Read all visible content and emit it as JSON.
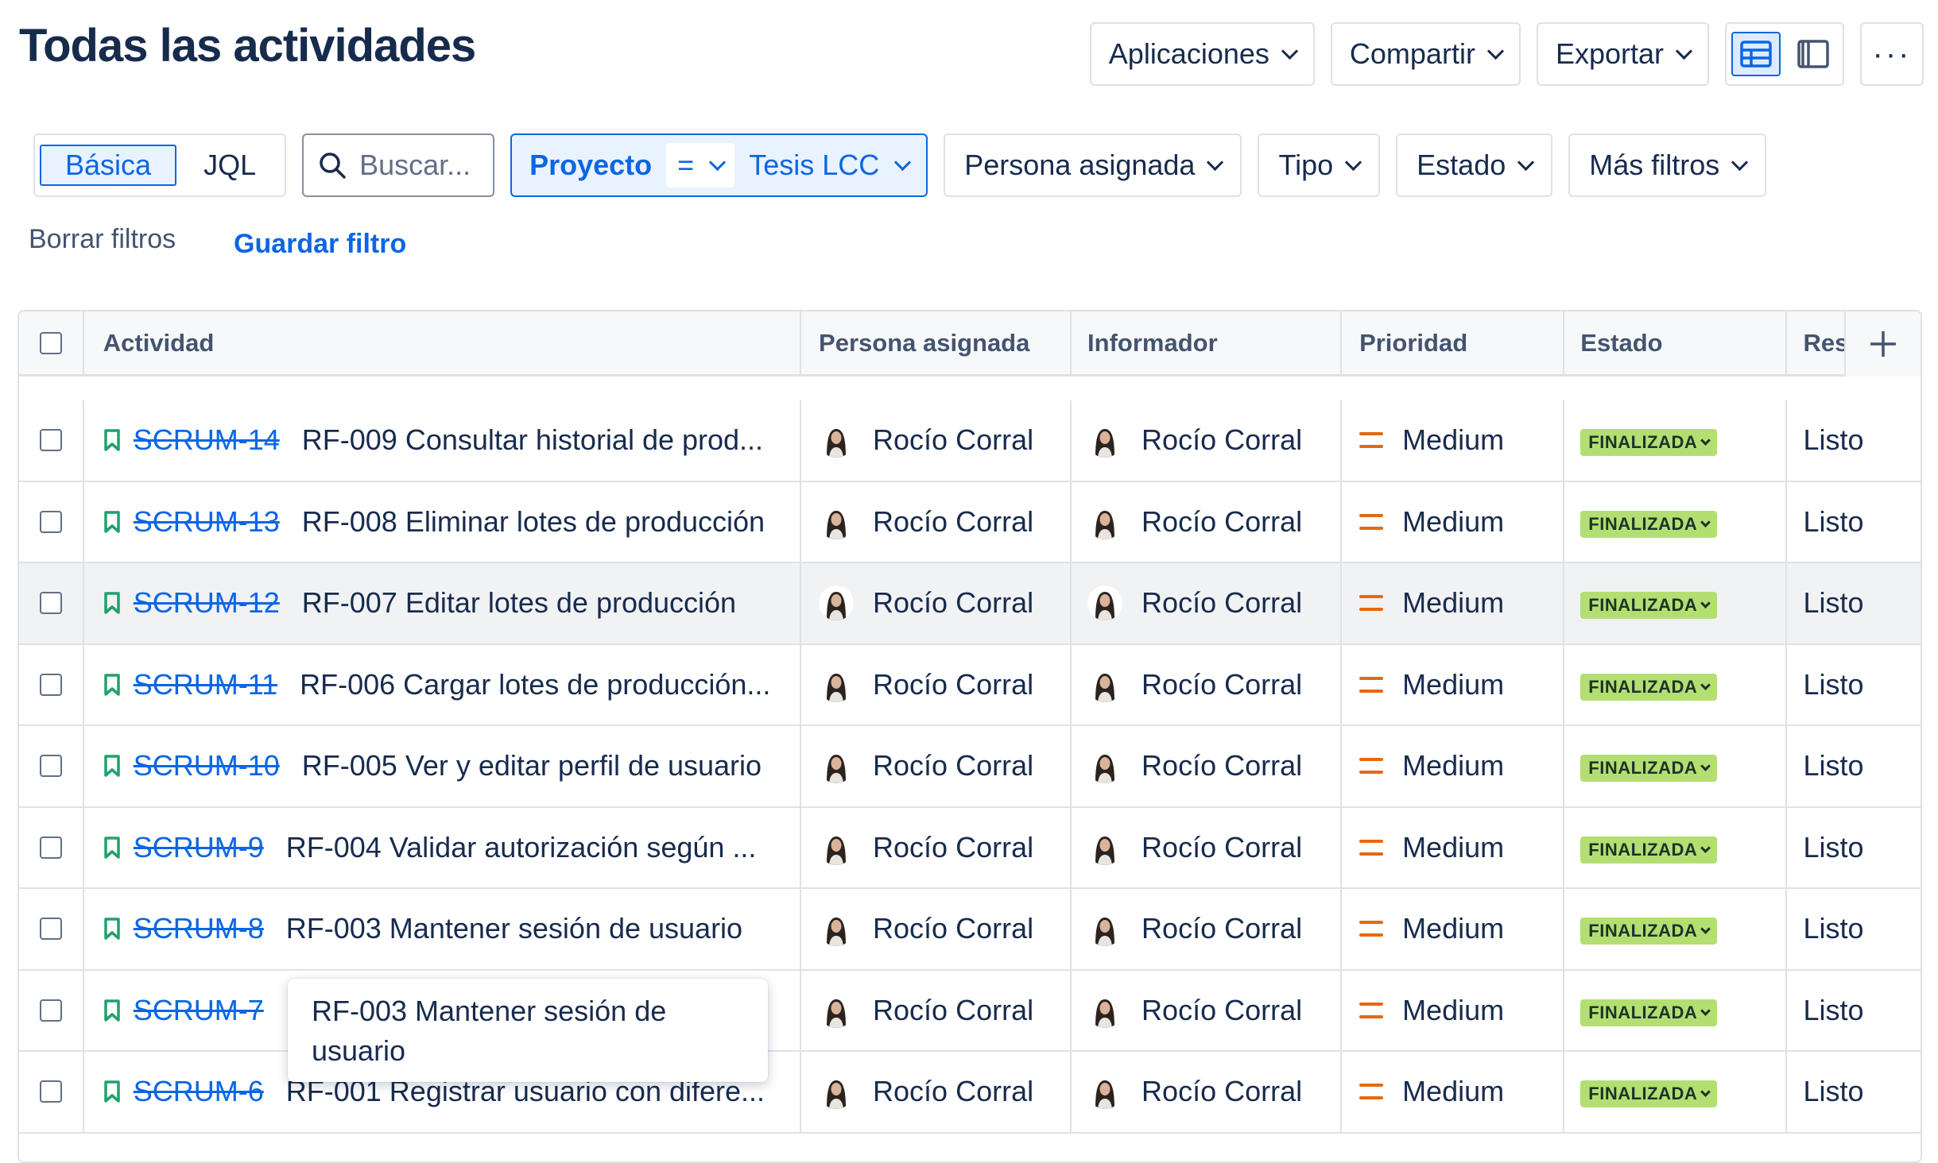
{
  "page": {
    "title": "Todas las actividades"
  },
  "toolbar": {
    "apps_label": "Aplicaciones",
    "share_label": "Compartir",
    "export_label": "Exportar",
    "more_label": "···"
  },
  "filters": {
    "basic_label": "Básica",
    "jql_label": "JQL",
    "search_placeholder": "Buscar...",
    "project_label": "Proyecto",
    "project_operator": "=",
    "project_value": "Tesis LCC",
    "assignee_label": "Persona asignada",
    "type_label": "Tipo",
    "status_label": "Estado",
    "more_filters_label": "Más filtros",
    "clear_label": "Borrar filtros",
    "save_label": "Guardar filtro"
  },
  "table": {
    "columns": [
      "Actividad",
      "Persona asignada",
      "Informador",
      "Prioridad",
      "Estado",
      "Res"
    ],
    "rows": [
      {
        "key": "SCRUM-14",
        "summary": "RF-009 Consultar historial de prod...",
        "assignee": "Rocío Corral",
        "reporter": "Rocío Corral",
        "priority": "Medium",
        "status": "FINALIZADA",
        "resolution": "Listo"
      },
      {
        "key": "SCRUM-13",
        "summary": "RF-008 Eliminar lotes de producción",
        "assignee": "Rocío Corral",
        "reporter": "Rocío Corral",
        "priority": "Medium",
        "status": "FINALIZADA",
        "resolution": "Listo"
      },
      {
        "key": "SCRUM-12",
        "summary": "RF-007 Editar lotes de producción",
        "assignee": "Rocío Corral",
        "reporter": "Rocío Corral",
        "priority": "Medium",
        "status": "FINALIZADA",
        "resolution": "Listo"
      },
      {
        "key": "SCRUM-11",
        "summary": "RF-006 Cargar lotes de producción...",
        "assignee": "Rocío Corral",
        "reporter": "Rocío Corral",
        "priority": "Medium",
        "status": "FINALIZADA",
        "resolution": "Listo"
      },
      {
        "key": "SCRUM-10",
        "summary": "RF-005 Ver y editar perfil de usuario",
        "assignee": "Rocío Corral",
        "reporter": "Rocío Corral",
        "priority": "Medium",
        "status": "FINALIZADA",
        "resolution": "Listo"
      },
      {
        "key": "SCRUM-9",
        "summary": "RF-004 Validar autorización según ...",
        "assignee": "Rocío Corral",
        "reporter": "Rocío Corral",
        "priority": "Medium",
        "status": "FINALIZADA",
        "resolution": "Listo"
      },
      {
        "key": "SCRUM-8",
        "summary": "RF-003 Mantener sesión de usuario",
        "assignee": "Rocío Corral",
        "reporter": "Rocío Corral",
        "priority": "Medium",
        "status": "FINALIZADA",
        "resolution": "Listo"
      },
      {
        "key": "SCRUM-7",
        "summary": "",
        "assignee": "Rocío Corral",
        "reporter": "Rocío Corral",
        "priority": "Medium",
        "status": "FINALIZADA",
        "resolution": "Listo"
      },
      {
        "key": "SCRUM-6",
        "summary": "RF-001 Registrar usuario con difere...",
        "assignee": "Rocío Corral",
        "reporter": "Rocío Corral",
        "priority": "Medium",
        "status": "FINALIZADA",
        "resolution": "Listo"
      }
    ]
  },
  "tooltip": {
    "text": "RF-003 Mantener sesión de usuario"
  },
  "colors": {
    "accent": "#0c66e4",
    "status_done_bg": "#b3df72",
    "priority_medium": "#e56910",
    "story_icon": "#22a06b"
  },
  "icons": {
    "story": "bookmark-icon",
    "search": "search-icon",
    "priority_medium": "priority-medium-icon",
    "add_column": "plus-icon"
  }
}
